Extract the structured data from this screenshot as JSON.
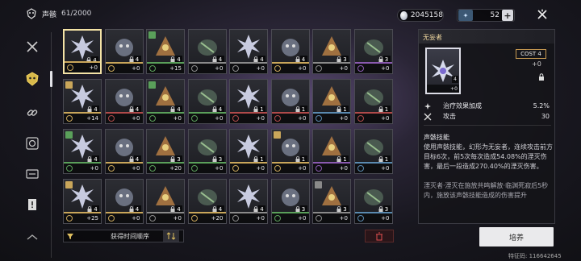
{
  "header": {
    "title": "声骸",
    "count": "61/2000",
    "currency_value": "2045158",
    "stamina_value": "52",
    "stamina_plus": "+"
  },
  "sidebar": {
    "items": [
      {
        "name": "weapon-tab",
        "icon": "crossed-swords-icon"
      },
      {
        "name": "echo-tab",
        "icon": "mask-icon",
        "active": true
      },
      {
        "name": "tuning-tab",
        "icon": "chain-icon"
      },
      {
        "name": "fusion-tab",
        "icon": "target-icon"
      },
      {
        "name": "data-tab",
        "icon": "card-icon"
      },
      {
        "name": "notice-tab",
        "icon": "alert-icon"
      },
      {
        "name": "more-tab",
        "icon": "chevron-icon"
      }
    ]
  },
  "grid": {
    "cards": [
      {
        "row": 0,
        "col": 0,
        "lvl": "4",
        "val": "+0",
        "color": "#c9a65a",
        "selected": true
      },
      {
        "row": 0,
        "col": 1,
        "lvl": "4",
        "val": "+0",
        "color": "#c9a65a"
      },
      {
        "row": 0,
        "col": 2,
        "lvl": "4",
        "val": "+15",
        "color": "#5aa05a",
        "badge": true
      },
      {
        "row": 0,
        "col": 3,
        "lvl": "4",
        "val": "+0",
        "color": "#8a8a8a"
      },
      {
        "row": 0,
        "col": 4,
        "lvl": "4",
        "val": "+0",
        "color": "#8a8a8a"
      },
      {
        "row": 0,
        "col": 5,
        "lvl": "4",
        "val": "+0",
        "color": "#c9a65a"
      },
      {
        "row": 0,
        "col": 6,
        "lvl": "3",
        "val": "+0",
        "color": "#8a8a8a"
      },
      {
        "row": 0,
        "col": 7,
        "lvl": "3",
        "val": "+0",
        "color": "#8a5ab0"
      },
      {
        "row": 1,
        "col": 0,
        "lvl": "4",
        "val": "+14",
        "color": "#c9a65a",
        "badge": true
      },
      {
        "row": 1,
        "col": 1,
        "lvl": "4",
        "val": "+0",
        "color": "#b04a4a"
      },
      {
        "row": 1,
        "col": 2,
        "lvl": "4",
        "val": "+0",
        "color": "#5aa05a",
        "badge": true
      },
      {
        "row": 1,
        "col": 3,
        "lvl": "4",
        "val": "+0",
        "color": "#5aa05a"
      },
      {
        "row": 1,
        "col": 4,
        "lvl": "1",
        "val": "+0",
        "color": "#b04a4a"
      },
      {
        "row": 1,
        "col": 5,
        "lvl": "1",
        "val": "+0",
        "color": "#b04a4a"
      },
      {
        "row": 1,
        "col": 6,
        "lvl": "1",
        "val": "+0",
        "color": "#5a8ab0"
      },
      {
        "row": 1,
        "col": 7,
        "lvl": "1",
        "val": "+0",
        "color": "#b04a4a"
      },
      {
        "row": 2,
        "col": 0,
        "lvl": "4",
        "val": "+0",
        "color": "#5aa05a",
        "badge": true
      },
      {
        "row": 2,
        "col": 1,
        "lvl": "4",
        "val": "+0",
        "color": "#c9a65a"
      },
      {
        "row": 2,
        "col": 2,
        "lvl": "3",
        "val": "+20",
        "color": "#5aa05a"
      },
      {
        "row": 2,
        "col": 3,
        "lvl": "3",
        "val": "+0",
        "color": "#5aa05a"
      },
      {
        "row": 2,
        "col": 4,
        "lvl": "1",
        "val": "+0",
        "color": "#c9a65a"
      },
      {
        "row": 2,
        "col": 5,
        "lvl": "1",
        "val": "+0",
        "color": "#c9a65a",
        "badge": true
      },
      {
        "row": 2,
        "col": 6,
        "lvl": "1",
        "val": "+0",
        "color": "#8a5ab0"
      },
      {
        "row": 2,
        "col": 7,
        "lvl": "1",
        "val": "+0",
        "color": "#5a8ab0"
      },
      {
        "row": 3,
        "col": 0,
        "lvl": "4",
        "val": "+25",
        "color": "#c9a65a",
        "badge": true
      },
      {
        "row": 3,
        "col": 1,
        "lvl": "4",
        "val": "+0",
        "color": "#c9a65a"
      },
      {
        "row": 3,
        "col": 2,
        "lvl": "4",
        "val": "+0",
        "color": "#8a8a8a"
      },
      {
        "row": 3,
        "col": 3,
        "lvl": "4",
        "val": "+20",
        "color": "#c9a65a"
      },
      {
        "row": 3,
        "col": 4,
        "lvl": "4",
        "val": "+0",
        "color": "#8a8a8a"
      },
      {
        "row": 3,
        "col": 5,
        "lvl": "3",
        "val": "+0",
        "color": "#5aa05a"
      },
      {
        "row": 3,
        "col": 6,
        "lvl": "3",
        "val": "+0",
        "color": "#8a8a8a",
        "badge": true
      },
      {
        "row": 3,
        "col": 7,
        "lvl": "3",
        "val": "+0",
        "color": "#5a8ab0"
      }
    ]
  },
  "sort": {
    "label": "获得时间顺序"
  },
  "detail": {
    "name": "无妄者",
    "cost_label": "COST 4",
    "plus": "+0",
    "portrait_lvl": "4",
    "portrait_val": "+0",
    "stats": [
      {
        "icon": "heal-icon",
        "name": "治疗效果加成",
        "value": "5.2%"
      },
      {
        "icon": "attack-icon",
        "name": "攻击",
        "value": "30"
      }
    ],
    "skill_title": "声骸技能",
    "skill_desc": "使用声骸技能，幻形为无妄者，连续攻击前方目标6次，前5次每次造成54.08%的湮灭伤害，最后一段造成270.40%的湮灭伤害。",
    "skill_note": "湮灭者·湮灭在施放共鸣解放·临渊死寂后5秒内，施放该声骸技能造成的伤害提升"
  },
  "actions": {
    "cultivate_label": "培养"
  },
  "footer": {
    "uid": "特征码: 116642645"
  }
}
